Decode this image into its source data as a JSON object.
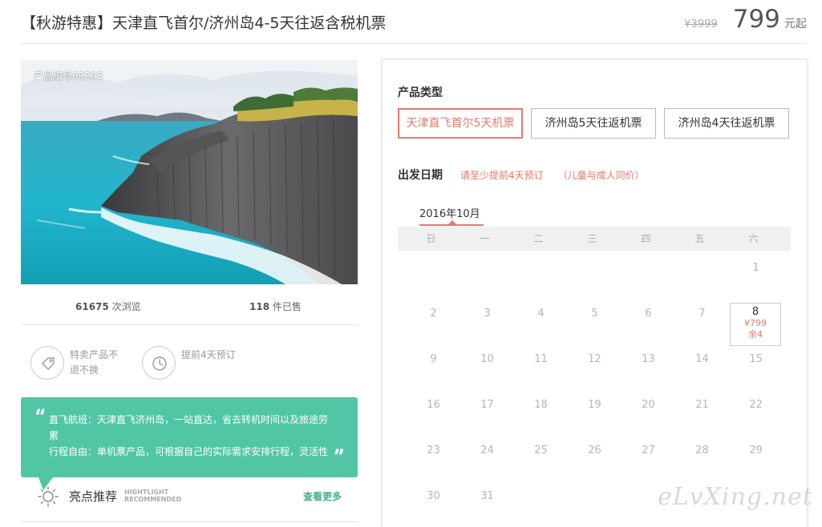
{
  "header": {
    "title": "【秋游特惠】天津直飞首尔/济州岛4-5天往返含税机票",
    "old_price": "¥3999",
    "price": "799",
    "price_unit": "元起"
  },
  "photo": {
    "product_id": "产品编号69293"
  },
  "stats": {
    "views_count": "61675",
    "views_label": " 次浏览",
    "sold_count": "118",
    "sold_label": " 件已售"
  },
  "features": [
    {
      "icon": "tag-icon",
      "text": "特卖产品不退不换"
    },
    {
      "icon": "clock-icon",
      "text": "提前4天预订"
    }
  ],
  "bubble": {
    "line1": "直飞航班：天津直飞济州岛，一站直达，省去转机时间以及旅途劳累",
    "line2": "行程自由：单机票产品，可根据自己的实际需求安排行程，灵活性"
  },
  "highlights": {
    "title": "亮点推荐",
    "en_line1": "HIGHTLIGHT",
    "en_line2": "RECOMMENDED",
    "more": "查看更多"
  },
  "booking": {
    "type_label": "产品类型",
    "types": [
      {
        "label": "天津直飞首尔5天机票",
        "active": true
      },
      {
        "label": "济州岛5天往返机票",
        "active": false
      },
      {
        "label": "济州岛4天往返机票",
        "active": false
      }
    ],
    "date_label": "出发日期",
    "note1": "请至少提前4天预订",
    "note2": "（儿童与成人同价）",
    "month": "2016年10月",
    "weekdays": [
      "日",
      "一",
      "二",
      "三",
      "四",
      "五",
      "六"
    ],
    "days": {
      "d1": "1",
      "d2": "2",
      "d3": "3",
      "d4": "4",
      "d5": "5",
      "d6": "6",
      "d7": "7",
      "d8": "8",
      "d9": "9",
      "d10": "10",
      "d11": "11",
      "d12": "12",
      "d13": "13",
      "d14": "14",
      "d15": "15",
      "d16": "16",
      "d17": "17",
      "d18": "18",
      "d19": "19",
      "d20": "20",
      "d21": "21",
      "d22": "22",
      "d23": "23",
      "d24": "24",
      "d25": "25",
      "d26": "26",
      "d27": "27",
      "d28": "28",
      "d29": "29",
      "d30": "30",
      "d31": "31"
    },
    "avail_price": "¥799",
    "avail_stock": "余4"
  },
  "watermark": "eLvXing.net",
  "colors": {
    "accent": "#e8776b",
    "green": "#52c6a4",
    "link_green": "#43b08b"
  }
}
